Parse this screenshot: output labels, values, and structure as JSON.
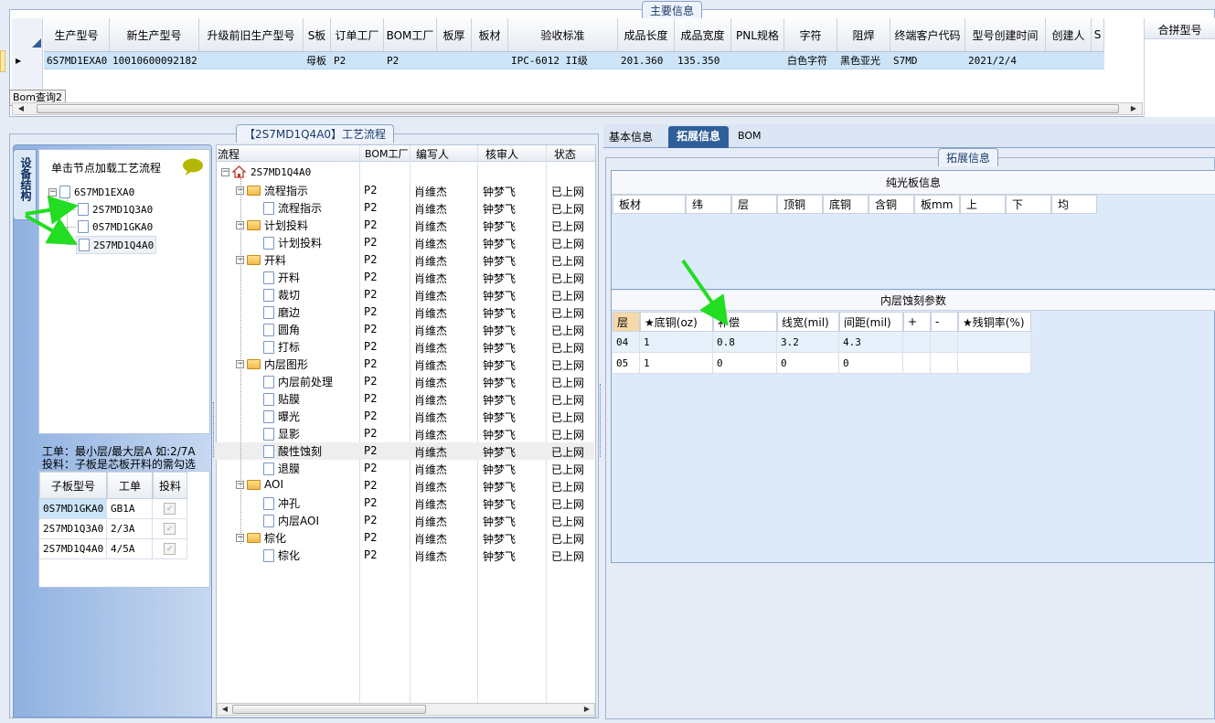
{
  "main_info": {
    "title": "主要信息",
    "columns": [
      "生产型号",
      "新生产型号",
      "升级前旧生产型号",
      "S板",
      "订单工厂",
      "BOM工厂",
      "板厚",
      "板材",
      "验收标准",
      "成品长度",
      "成品宽度",
      "PNL规格",
      "字符",
      "阻焊",
      "终端客户代码",
      "型号创建时间",
      "创建人",
      "S"
    ],
    "row": [
      "6S7MD1EXA0",
      "10010600092182",
      "",
      "母板",
      "P2",
      "P2",
      "",
      "",
      "IPC-6012 II级",
      "201.360",
      "135.350",
      "",
      "白色字符",
      "黑色亚光",
      "S7MD",
      "2021/2/4",
      "",
      ""
    ],
    "merge_label": "合拼型号",
    "bom_query_label": "Bom查询2"
  },
  "process_flow": {
    "title": "【2S7MD1Q4A0】工艺流程"
  },
  "side_tab": {
    "label": "设备结构"
  },
  "left_panel": {
    "hint": "单击节点加载工艺流程",
    "tree": {
      "root": "6S7MD1EXA0",
      "children": [
        "2S7MD1Q3A0",
        "0S7MD1GKA0",
        "2S7MD1Q4A0"
      ]
    },
    "note_line1": "工单：最小层/最大层A 如:2/7A",
    "note_line2": "投料：子板是芯板开料的需勾选",
    "subboard_headers": [
      "子板型号",
      "工单",
      "投料"
    ],
    "subboards": [
      {
        "model": "0S7MD1GKA0",
        "order": "GB1A",
        "feed": "✓"
      },
      {
        "model": "2S7MD1Q3A0",
        "order": "2/3A",
        "feed": "✓"
      },
      {
        "model": "2S7MD1Q4A0",
        "order": "4/5A",
        "feed": "✓"
      }
    ]
  },
  "flow_tree": {
    "headers": [
      "流程",
      "BOM工厂",
      "编写人",
      "核审人",
      "状态"
    ],
    "root": "2S7MD1Q4A0",
    "rows": [
      {
        "name": "流程指示",
        "level": 1,
        "folder": true,
        "factory": "P2",
        "writer": "肖维杰",
        "reviewer": "钟梦飞",
        "status": "已上网"
      },
      {
        "name": "流程指示",
        "level": 2,
        "folder": false,
        "factory": "P2",
        "writer": "肖维杰",
        "reviewer": "钟梦飞",
        "status": "已上网"
      },
      {
        "name": "计划投料",
        "level": 1,
        "folder": true,
        "factory": "P2",
        "writer": "肖维杰",
        "reviewer": "钟梦飞",
        "status": "已上网"
      },
      {
        "name": "计划投料",
        "level": 2,
        "folder": false,
        "factory": "P2",
        "writer": "肖维杰",
        "reviewer": "钟梦飞",
        "status": "已上网"
      },
      {
        "name": "开料",
        "level": 1,
        "folder": true,
        "factory": "P2",
        "writer": "肖维杰",
        "reviewer": "钟梦飞",
        "status": "已上网"
      },
      {
        "name": "开料",
        "level": 2,
        "folder": false,
        "factory": "P2",
        "writer": "肖维杰",
        "reviewer": "钟梦飞",
        "status": "已上网"
      },
      {
        "name": "裁切",
        "level": 2,
        "folder": false,
        "factory": "P2",
        "writer": "肖维杰",
        "reviewer": "钟梦飞",
        "status": "已上网"
      },
      {
        "name": "磨边",
        "level": 2,
        "folder": false,
        "factory": "P2",
        "writer": "肖维杰",
        "reviewer": "钟梦飞",
        "status": "已上网"
      },
      {
        "name": "圆角",
        "level": 2,
        "folder": false,
        "factory": "P2",
        "writer": "肖维杰",
        "reviewer": "钟梦飞",
        "status": "已上网"
      },
      {
        "name": "打标",
        "level": 2,
        "folder": false,
        "factory": "P2",
        "writer": "肖维杰",
        "reviewer": "钟梦飞",
        "status": "已上网"
      },
      {
        "name": "内层图形",
        "level": 1,
        "folder": true,
        "factory": "P2",
        "writer": "肖维杰",
        "reviewer": "钟梦飞",
        "status": "已上网"
      },
      {
        "name": "内层前处理",
        "level": 2,
        "folder": false,
        "factory": "P2",
        "writer": "肖维杰",
        "reviewer": "钟梦飞",
        "status": "已上网"
      },
      {
        "name": "贴膜",
        "level": 2,
        "folder": false,
        "factory": "P2",
        "writer": "肖维杰",
        "reviewer": "钟梦飞",
        "status": "已上网"
      },
      {
        "name": "曝光",
        "level": 2,
        "folder": false,
        "factory": "P2",
        "writer": "肖维杰",
        "reviewer": "钟梦飞",
        "status": "已上网"
      },
      {
        "name": "显影",
        "level": 2,
        "folder": false,
        "factory": "P2",
        "writer": "肖维杰",
        "reviewer": "钟梦飞",
        "status": "已上网"
      },
      {
        "name": "酸性蚀刻",
        "level": 2,
        "folder": false,
        "factory": "P2",
        "writer": "肖维杰",
        "reviewer": "钟梦飞",
        "status": "已上网",
        "selected": true
      },
      {
        "name": "退膜",
        "level": 2,
        "folder": false,
        "factory": "P2",
        "writer": "肖维杰",
        "reviewer": "钟梦飞",
        "status": "已上网"
      },
      {
        "name": "AOI",
        "level": 1,
        "folder": true,
        "factory": "P2",
        "writer": "肖维杰",
        "reviewer": "钟梦飞",
        "status": "已上网"
      },
      {
        "name": "冲孔",
        "level": 2,
        "folder": false,
        "factory": "P2",
        "writer": "肖维杰",
        "reviewer": "钟梦飞",
        "status": "已上网"
      },
      {
        "name": "内层AOI",
        "level": 2,
        "folder": false,
        "factory": "P2",
        "writer": "肖维杰",
        "reviewer": "钟梦飞",
        "status": "已上网"
      },
      {
        "name": "棕化",
        "level": 1,
        "folder": true,
        "factory": "P2",
        "writer": "肖维杰",
        "reviewer": "钟梦飞",
        "status": "已上网"
      },
      {
        "name": "棕化",
        "level": 2,
        "folder": false,
        "factory": "P2",
        "writer": "肖维杰",
        "reviewer": "钟梦飞",
        "status": "已上网"
      }
    ]
  },
  "right_panel": {
    "tabs": [
      "基本信息",
      "拓展信息",
      "BOM"
    ],
    "active_tab": "拓展信息",
    "ext_title": "拓展信息",
    "plain_board_title": "纯光板信息",
    "plain_board_headers": [
      "板材",
      "纬",
      "层",
      "顶铜",
      "底铜",
      "含铜",
      "板mm",
      "上",
      "下",
      "均"
    ],
    "etch_title": "内层蚀刻参数",
    "etch_headers": [
      "层",
      "★底铜(oz)",
      "补偿",
      "线宽(mil)",
      "间距(mil)",
      "+",
      "-",
      "★残铜率(%)"
    ],
    "etch_rows": [
      [
        "04",
        "1",
        "0.8",
        "3.2",
        "4.3",
        "",
        "",
        ""
      ],
      [
        "05",
        "1",
        "0",
        "0",
        "0",
        "",
        "",
        ""
      ]
    ]
  },
  "colors": {
    "selection": "#cce4f7",
    "header_accent": "#2f5f9a",
    "annotation_arrow": "#22dd22"
  }
}
